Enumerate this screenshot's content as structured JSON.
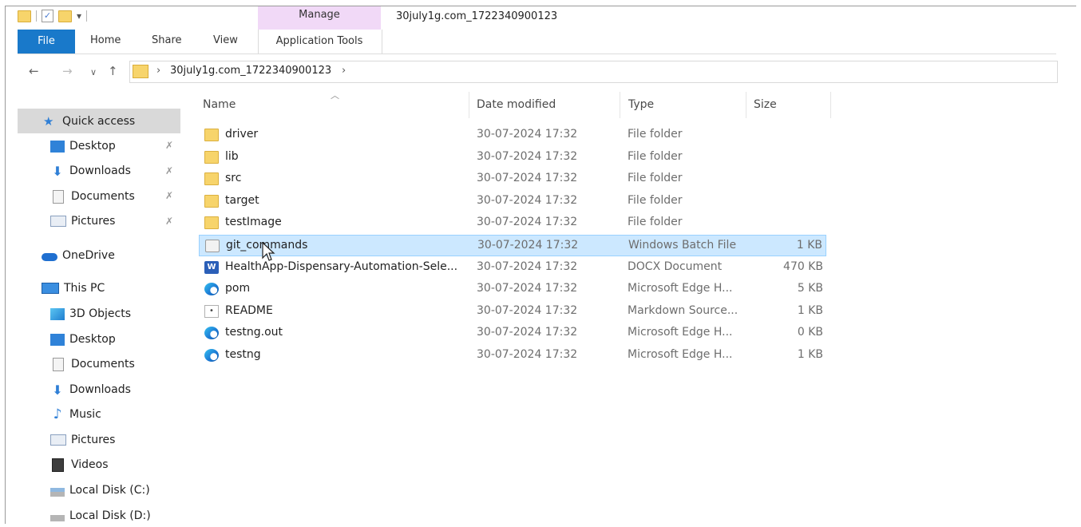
{
  "window": {
    "title": "30july1g.com_1722340900123"
  },
  "ribbon": {
    "contextual_group": "Manage",
    "tabs": {
      "file": "File",
      "home": "Home",
      "share": "Share",
      "view": "View",
      "application_tools": "Application Tools"
    }
  },
  "address": {
    "path_segment": "30july1g.com_1722340900123"
  },
  "sidebar": {
    "quick_access": "Quick access",
    "quick_items": [
      "Desktop",
      "Downloads",
      "Documents",
      "Pictures"
    ],
    "onedrive": "OneDrive",
    "this_pc": "This PC",
    "pc_items": [
      "3D Objects",
      "Desktop",
      "Documents",
      "Downloads",
      "Music",
      "Pictures",
      "Videos",
      "Local Disk (C:)",
      "Local Disk (D:)"
    ]
  },
  "columns": {
    "name": "Name",
    "date": "Date modified",
    "type": "Type",
    "size": "Size"
  },
  "files": [
    {
      "name": "driver",
      "date": "30-07-2024 17:32",
      "type": "File folder",
      "size": "",
      "icon": "folder-icon"
    },
    {
      "name": "lib",
      "date": "30-07-2024 17:32",
      "type": "File folder",
      "size": "",
      "icon": "folder-icon"
    },
    {
      "name": "src",
      "date": "30-07-2024 17:32",
      "type": "File folder",
      "size": "",
      "icon": "folder-icon"
    },
    {
      "name": "target",
      "date": "30-07-2024 17:32",
      "type": "File folder",
      "size": "",
      "icon": "folder-icon"
    },
    {
      "name": "testImage",
      "date": "30-07-2024 17:32",
      "type": "File folder",
      "size": "",
      "icon": "folder-icon"
    },
    {
      "name": "git_commands",
      "date": "30-07-2024 17:32",
      "type": "Windows Batch File",
      "size": "1 KB",
      "icon": "batch-file-icon",
      "selected": true
    },
    {
      "name": "HealthApp-Dispensary-Automation-Sele...",
      "date": "30-07-2024 17:32",
      "type": "DOCX Document",
      "size": "470 KB",
      "icon": "word-document-icon"
    },
    {
      "name": "pom",
      "date": "30-07-2024 17:32",
      "type": "Microsoft Edge H...",
      "size": "5 KB",
      "icon": "edge-html-icon"
    },
    {
      "name": "README",
      "date": "30-07-2024 17:32",
      "type": "Markdown Source...",
      "size": "1 KB",
      "icon": "markdown-file-icon"
    },
    {
      "name": "testng.out",
      "date": "30-07-2024 17:32",
      "type": "Microsoft Edge H...",
      "size": "0 KB",
      "icon": "edge-html-icon"
    },
    {
      "name": "testng",
      "date": "30-07-2024 17:32",
      "type": "Microsoft Edge H...",
      "size": "1 KB",
      "icon": "edge-html-icon"
    }
  ],
  "colors": {
    "file_tab": "#1979ca",
    "manage_tab": "#f1d9f7",
    "selection": "#cce8ff",
    "folder": "#f7d46b"
  }
}
